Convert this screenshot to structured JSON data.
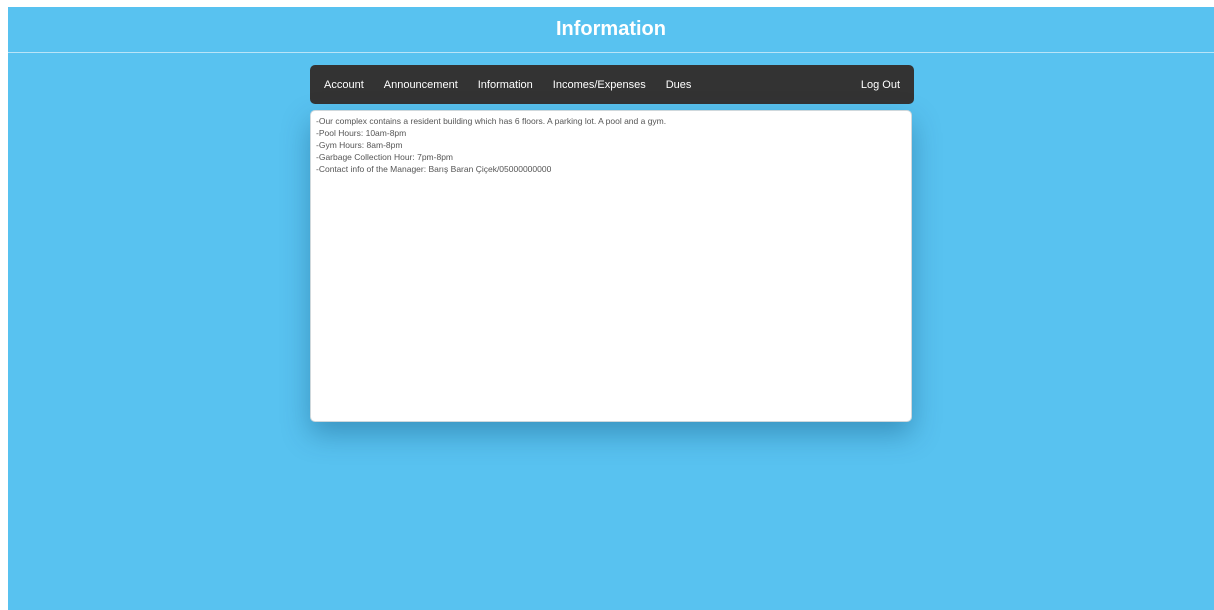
{
  "header": {
    "title": "Information"
  },
  "nav": {
    "items": [
      {
        "label": "Account"
      },
      {
        "label": "Announcement"
      },
      {
        "label": "Information"
      },
      {
        "label": "Incomes/Expenses"
      },
      {
        "label": "Dues"
      }
    ],
    "logout_label": "Log Out"
  },
  "content": {
    "lines": [
      "-Our complex contains a resident building which has 6 floors. A parking lot. A pool and a gym.",
      "-Pool Hours: 10am-8pm",
      "-Gym Hours: 8am-8pm",
      "-Garbage Collection Hour: 7pm-8pm",
      "-Contact info of the Manager: Barış Baran Çiçek/05000000000"
    ]
  },
  "colors": {
    "background": "#58c2f0",
    "nav_background": "#333333",
    "text_primary": "#ffffff"
  }
}
